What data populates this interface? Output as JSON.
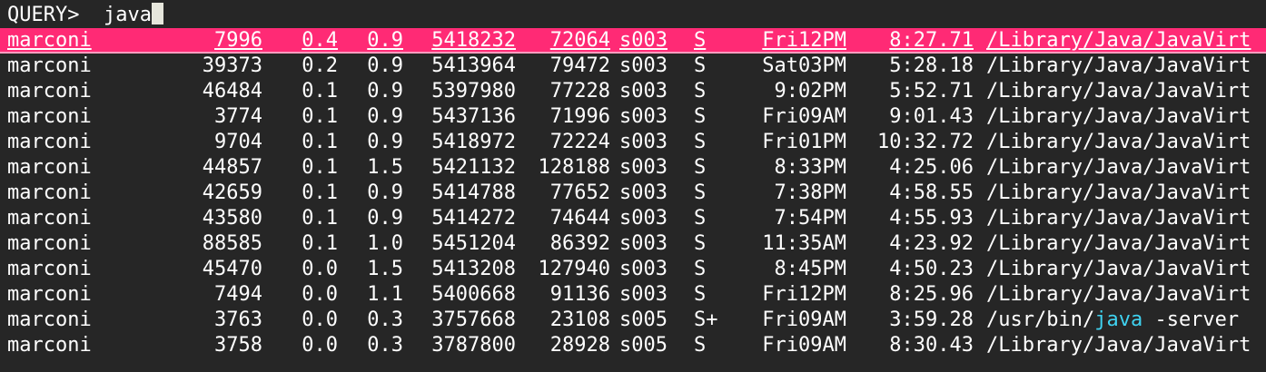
{
  "prompt": {
    "label": "QUERY>",
    "value": "java"
  },
  "colors": {
    "background": "#262626",
    "text": "#ffffff",
    "selection": "#ff2a75",
    "match_highlight": "#3fd2f0",
    "cursor": "#e6e6dc"
  },
  "processes": [
    {
      "user": "marconi",
      "pid": "7996",
      "cpu": "0.4",
      "mem": "0.9",
      "vsz": "5418232",
      "rss": "72064",
      "tty": "s003",
      "stat": "S",
      "started": "Fri12PM",
      "time": "8:27.71",
      "cmd_pre": "/Library/Java/JavaVirt",
      "cmd_match": "",
      "cmd_post": ""
    },
    {
      "user": "marconi",
      "pid": "39373",
      "cpu": "0.2",
      "mem": "0.9",
      "vsz": "5413964",
      "rss": "79472",
      "tty": "s003",
      "stat": "S",
      "started": "Sat03PM",
      "time": "5:28.18",
      "cmd_pre": "/Library/Java/JavaVirt",
      "cmd_match": "",
      "cmd_post": ""
    },
    {
      "user": "marconi",
      "pid": "46484",
      "cpu": "0.1",
      "mem": "0.9",
      "vsz": "5397980",
      "rss": "77228",
      "tty": "s003",
      "stat": "S",
      "started": "9:02PM",
      "time": "5:52.71",
      "cmd_pre": "/Library/Java/JavaVirt",
      "cmd_match": "",
      "cmd_post": ""
    },
    {
      "user": "marconi",
      "pid": "3774",
      "cpu": "0.1",
      "mem": "0.9",
      "vsz": "5437136",
      "rss": "71996",
      "tty": "s003",
      "stat": "S",
      "started": "Fri09AM",
      "time": "9:01.43",
      "cmd_pre": "/Library/Java/JavaVirt",
      "cmd_match": "",
      "cmd_post": ""
    },
    {
      "user": "marconi",
      "pid": "9704",
      "cpu": "0.1",
      "mem": "0.9",
      "vsz": "5418972",
      "rss": "72224",
      "tty": "s003",
      "stat": "S",
      "started": "Fri01PM",
      "time": "10:32.72",
      "cmd_pre": "/Library/Java/JavaVirt",
      "cmd_match": "",
      "cmd_post": ""
    },
    {
      "user": "marconi",
      "pid": "44857",
      "cpu": "0.1",
      "mem": "1.5",
      "vsz": "5421132",
      "rss": "128188",
      "tty": "s003",
      "stat": "S",
      "started": "8:33PM",
      "time": "4:25.06",
      "cmd_pre": "/Library/Java/JavaVirt",
      "cmd_match": "",
      "cmd_post": ""
    },
    {
      "user": "marconi",
      "pid": "42659",
      "cpu": "0.1",
      "mem": "0.9",
      "vsz": "5414788",
      "rss": "77652",
      "tty": "s003",
      "stat": "S",
      "started": "7:38PM",
      "time": "4:58.55",
      "cmd_pre": "/Library/Java/JavaVirt",
      "cmd_match": "",
      "cmd_post": ""
    },
    {
      "user": "marconi",
      "pid": "43580",
      "cpu": "0.1",
      "mem": "0.9",
      "vsz": "5414272",
      "rss": "74644",
      "tty": "s003",
      "stat": "S",
      "started": "7:54PM",
      "time": "4:55.93",
      "cmd_pre": "/Library/Java/JavaVirt",
      "cmd_match": "",
      "cmd_post": ""
    },
    {
      "user": "marconi",
      "pid": "88585",
      "cpu": "0.1",
      "mem": "1.0",
      "vsz": "5451204",
      "rss": "86392",
      "tty": "s003",
      "stat": "S",
      "started": "11:35AM",
      "time": "4:23.92",
      "cmd_pre": "/Library/Java/JavaVirt",
      "cmd_match": "",
      "cmd_post": ""
    },
    {
      "user": "marconi",
      "pid": "45470",
      "cpu": "0.0",
      "mem": "1.5",
      "vsz": "5413208",
      "rss": "127940",
      "tty": "s003",
      "stat": "S",
      "started": "8:45PM",
      "time": "4:50.23",
      "cmd_pre": "/Library/Java/JavaVirt",
      "cmd_match": "",
      "cmd_post": ""
    },
    {
      "user": "marconi",
      "pid": "7494",
      "cpu": "0.0",
      "mem": "1.1",
      "vsz": "5400668",
      "rss": "91136",
      "tty": "s003",
      "stat": "S",
      "started": "Fri12PM",
      "time": "8:25.96",
      "cmd_pre": "/Library/Java/JavaVirt",
      "cmd_match": "",
      "cmd_post": ""
    },
    {
      "user": "marconi",
      "pid": "3763",
      "cpu": "0.0",
      "mem": "0.3",
      "vsz": "3757668",
      "rss": "23108",
      "tty": "s005",
      "stat": "S+",
      "started": "Fri09AM",
      "time": "3:59.28",
      "cmd_pre": "/usr/bin/",
      "cmd_match": "java",
      "cmd_post": " -server"
    },
    {
      "user": "marconi",
      "pid": "3758",
      "cpu": "0.0",
      "mem": "0.3",
      "vsz": "3787800",
      "rss": "28928",
      "tty": "s005",
      "stat": "S",
      "started": "Fri09AM",
      "time": "8:30.43",
      "cmd_pre": "/Library/Java/JavaVirt",
      "cmd_match": "",
      "cmd_post": ""
    }
  ]
}
